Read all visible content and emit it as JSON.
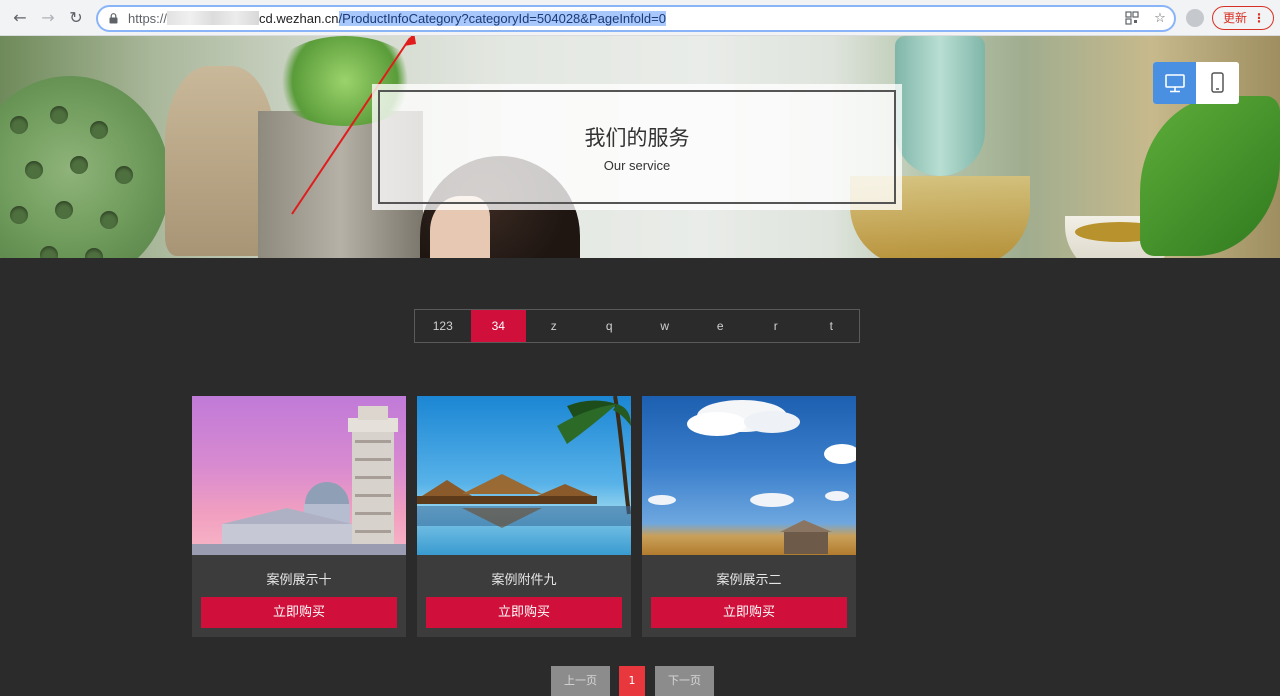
{
  "browser": {
    "url_scheme": "https://",
    "url_host_suffix": "cd.wezhan.cn",
    "url_path": "/ProductInfoCategory?categoryId=504028&PageInfold=0",
    "update_label": "更新",
    "accent_color": "#8ab4f8"
  },
  "banner": {
    "title_cn": "我们的服务",
    "title_en": "Our service"
  },
  "device_toggle": {
    "active": "desktop-icon",
    "inactive": "mobile-icon",
    "active_color": "#4a90e2"
  },
  "category_tabs": [
    {
      "label": "123",
      "active": false
    },
    {
      "label": "34",
      "active": true
    },
    {
      "label": "z",
      "active": false
    },
    {
      "label": "q",
      "active": false
    },
    {
      "label": "w",
      "active": false
    },
    {
      "label": "e",
      "active": false
    },
    {
      "label": "r",
      "active": false
    },
    {
      "label": "t",
      "active": false
    }
  ],
  "products": [
    {
      "name": "案例展示十",
      "button": "立即购买",
      "image": "pisa-tower"
    },
    {
      "name": "案例附件九",
      "button": "立即购买",
      "image": "beach-huts"
    },
    {
      "name": "案例展示二",
      "button": "立即购买",
      "image": "farm-field"
    }
  ],
  "pagination": {
    "prev_label": "上一页",
    "current": "1",
    "next_label": "下一页"
  },
  "colors": {
    "brand_red": "#d0103a",
    "page_bg": "#2b2b2b",
    "card_bg": "#3c3c3c"
  }
}
